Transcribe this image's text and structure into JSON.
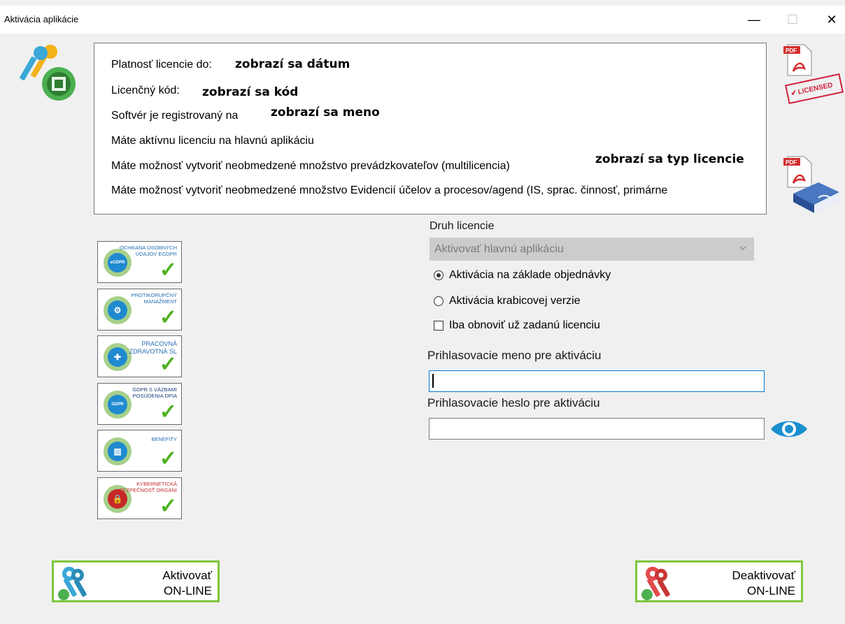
{
  "window": {
    "title": "Aktivácia aplikácie",
    "minimize_glyph": "—",
    "maximize_glyph": "☐",
    "close_glyph": "✕"
  },
  "info": {
    "lines": [
      "Platnosť licencie do:",
      "Licenčný kód:",
      "Softvér je registrovaný na",
      "Máte aktívnu licenciu na hlavnú aplikáciu",
      "Máte možnosť vytvoriť neobmedzené množstvo prevádzkovateľov (multilicencia)",
      "Máte možnosť vytvoriť neobmedzené množstvo Evidencií účelov a procesov/agend (IS, sprac. činnosť, primárne"
    ],
    "values": {
      "date": "zobrazí sa dátum",
      "code": "zobrazí sa kód",
      "name": "zobrazí sa meno",
      "license_type": "zobrazí sa typ licencie"
    }
  },
  "side_icons": {
    "pdf_label": "PDF",
    "licensed_stamp": "LICENSED"
  },
  "modules": [
    {
      "caption": "OCHRANA OSOBNÝCH ÚDAJOV eGDPR",
      "badge": "eGDPR",
      "color": "blue"
    },
    {
      "caption": "PROTIKORUPČNÝ MANAŽMENT",
      "badge": "⚙",
      "color": "blue"
    },
    {
      "caption": "PRACOVNÁ ZDRAVOTNÁ SL",
      "badge": "✚",
      "color": "blue"
    },
    {
      "caption": "GDPR S VÄZBAMI POSÚDENIA DPIA",
      "badge": "GDPR",
      "color": "blue"
    },
    {
      "caption": "BENEFITY",
      "badge": "▥",
      "color": "blue"
    },
    {
      "caption": "KYBERNETICKÁ BEZPEČNOSŤ ORGANI",
      "badge": "🔒",
      "color": "red"
    }
  ],
  "form": {
    "license_type_label": "Druh licencie",
    "license_type_value": "Aktivovať hlavnú aplikáciu",
    "radio_order": "Aktivácia na základe objednávky",
    "radio_box": "Aktivácia krabicovej verzie",
    "checkbox_refresh": "Iba obnoviť už zadanú licenciu",
    "username_label": "Prihlasovacie meno pre aktiváciu",
    "username_value": "",
    "password_label": "Prihlasovacie heslo pre aktiváciu",
    "password_value": ""
  },
  "buttons": {
    "activate_line1": "Aktivovať",
    "activate_line2": "ON-LINE",
    "deactivate_line1": "Deaktivovať",
    "deactivate_line2": "ON-LINE"
  },
  "colors": {
    "accent_green": "#7ec63e",
    "focus_blue": "#0078d7",
    "eye_blue": "#1b8fcf",
    "key_cyan": "#3aa7d6",
    "key_red": "#e24b4b"
  }
}
